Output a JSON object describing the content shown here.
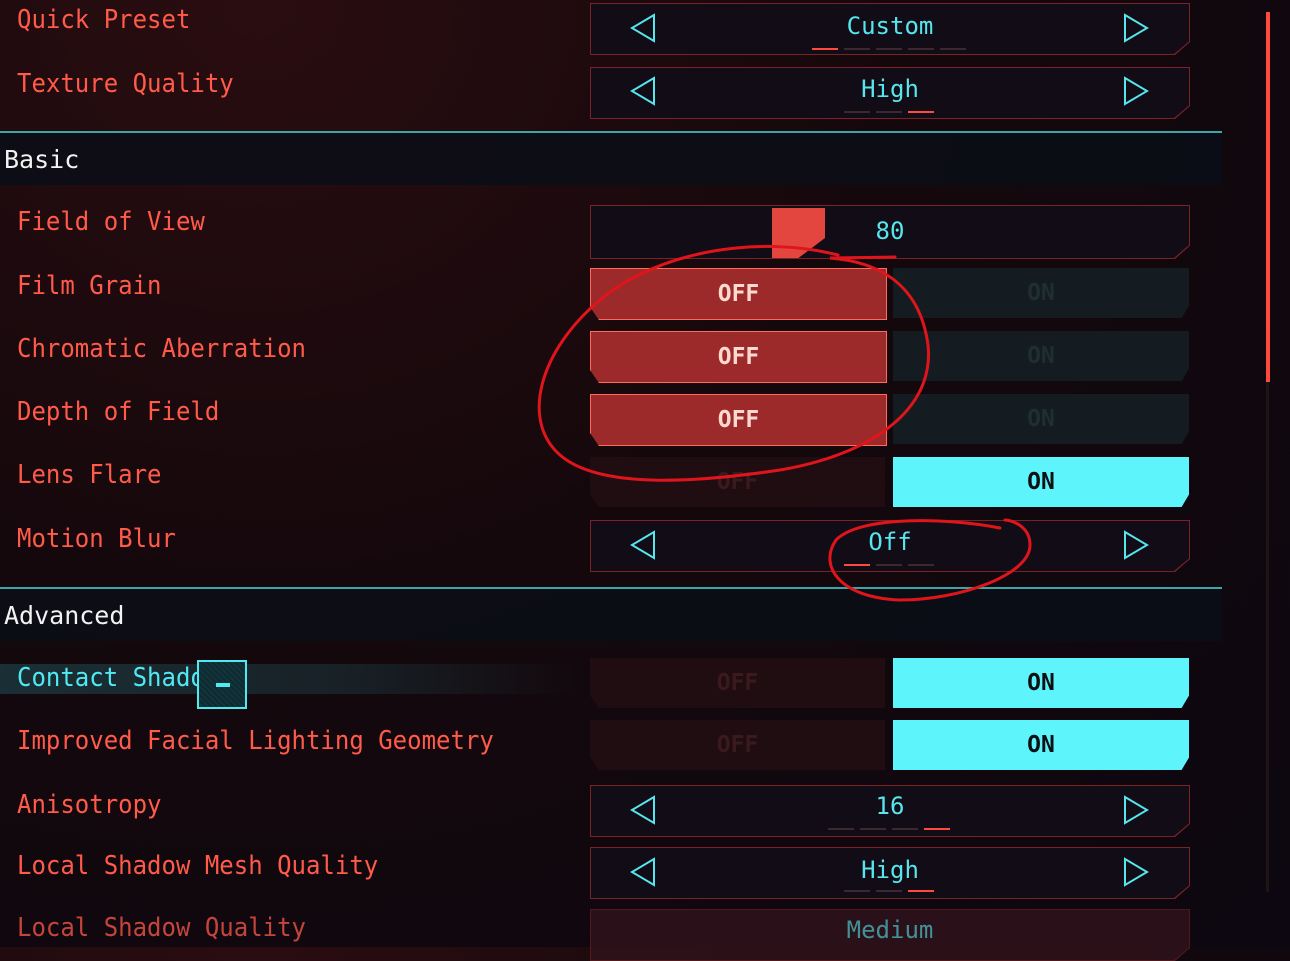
{
  "colors": {
    "accent_red": "#ff5a4a",
    "accent_cyan": "#5ef4fb",
    "section_title": "#f2f2f2",
    "annotation": "#e0151c"
  },
  "top": {
    "quick_preset": {
      "label": "Quick Preset",
      "value": "Custom"
    },
    "texture_quality": {
      "label": "Texture Quality",
      "value": "High"
    }
  },
  "basic": {
    "title": "Basic",
    "field_of_view": {
      "label": "Field of View",
      "value": "80"
    },
    "film_grain": {
      "label": "Film Grain",
      "off": "OFF",
      "on": "ON",
      "state": "OFF"
    },
    "chromatic_aberration": {
      "label": "Chromatic Aberration",
      "off": "OFF",
      "on": "ON",
      "state": "OFF"
    },
    "depth_of_field": {
      "label": "Depth of Field",
      "off": "OFF",
      "on": "ON",
      "state": "OFF"
    },
    "lens_flare": {
      "label": "Lens Flare",
      "off": "OFF",
      "on": "ON",
      "state": "ON"
    },
    "motion_blur": {
      "label": "Motion Blur",
      "value": "Off"
    }
  },
  "advanced": {
    "title": "Advanced",
    "contact_shadows": {
      "label": "Contact Shadows",
      "off": "OFF",
      "on": "ON",
      "state": "ON"
    },
    "improved_facial_lighting": {
      "label": "Improved Facial Lighting Geometry",
      "off": "OFF",
      "on": "ON",
      "state": "ON"
    },
    "anisotropy": {
      "label": "Anisotropy",
      "value": "16"
    },
    "local_shadow_mesh_quality": {
      "label": "Local Shadow Mesh Quality",
      "value": "High"
    },
    "local_shadow_quality": {
      "label": "Local Shadow Quality",
      "value": "Medium"
    }
  },
  "icons": {
    "prev": "triangle-left-outline",
    "next": "triangle-right-outline",
    "checkbox": "partial-checkbox"
  }
}
